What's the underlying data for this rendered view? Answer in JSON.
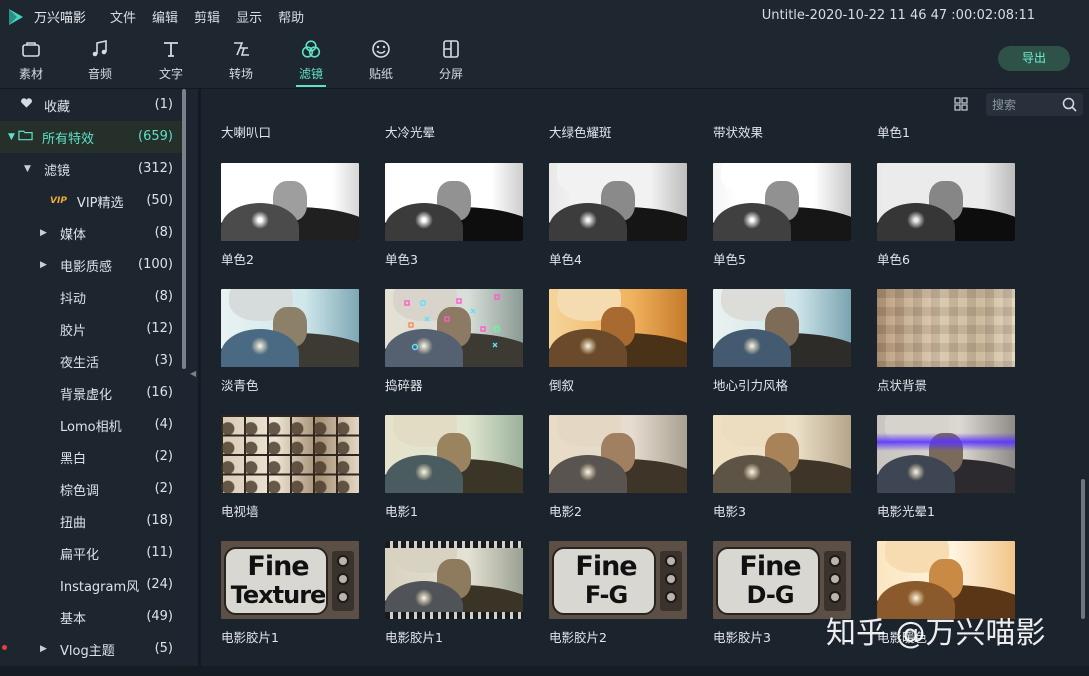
{
  "app": {
    "name": "万兴喵影",
    "project_title": "Untitle-2020-10-22 11 46 47 :00:02:08:11"
  },
  "menu": [
    "文件",
    "编辑",
    "剪辑",
    "显示",
    "帮助"
  ],
  "toolbar": {
    "tools": [
      {
        "label": "素材",
        "icon": "media-icon"
      },
      {
        "label": "音频",
        "icon": "music-icon"
      },
      {
        "label": "文字",
        "icon": "text-icon"
      },
      {
        "label": "转场",
        "icon": "transition-icon"
      },
      {
        "label": "滤镜",
        "icon": "filter-icon",
        "active": true
      },
      {
        "label": "贴纸",
        "icon": "sticker-icon"
      },
      {
        "label": "分屏",
        "icon": "split-screen-icon"
      }
    ],
    "export_label": "导出",
    "accent_color": "#5fe1c6"
  },
  "sidebar": {
    "items": [
      {
        "label": "收藏",
        "count": "(1)",
        "icon": "heart-icon"
      },
      {
        "label": "所有特效",
        "count": "(659)",
        "icon": "folder-icon",
        "expanded": true,
        "selected": true
      },
      {
        "label": "滤镜",
        "count": "(312)",
        "expanded": true
      },
      {
        "label": "VIP精选",
        "count": "(50)",
        "badge": "VIP"
      },
      {
        "label": "媒体",
        "count": "(8)",
        "collapsed": true
      },
      {
        "label": "电影质感",
        "count": "(100)",
        "collapsed": true
      },
      {
        "label": "抖动",
        "count": "(8)"
      },
      {
        "label": "胶片",
        "count": "(12)"
      },
      {
        "label": "夜生活",
        "count": "(3)"
      },
      {
        "label": "背景虚化",
        "count": "(16)"
      },
      {
        "label": "Lomo相机",
        "count": "(4)"
      },
      {
        "label": "黑白",
        "count": "(2)"
      },
      {
        "label": "棕色调",
        "count": "(2)"
      },
      {
        "label": "扭曲",
        "count": "(18)"
      },
      {
        "label": "扁平化",
        "count": "(11)"
      },
      {
        "label": "Instagram风",
        "count": "(24)"
      },
      {
        "label": "基本",
        "count": "(49)"
      },
      {
        "label": "Vlog主题",
        "count": "(5)",
        "collapsed": true
      }
    ]
  },
  "search": {
    "placeholder": "搜索"
  },
  "grid": {
    "top_row_labels": [
      "大喇叭口",
      "大冷光晕",
      "大绿色耀斑",
      "带状效果",
      "单色1"
    ],
    "rows": [
      [
        "单色2",
        "单色3",
        "单色4",
        "单色5",
        "单色6"
      ],
      [
        "淡青色",
        "捣碎器",
        "倒叙",
        "地心引力风格",
        "点状背景"
      ],
      [
        "电视墙",
        "电影1",
        "电影2",
        "电影3",
        "电影光晕1"
      ],
      [
        "电影胶片1",
        "电影胶片1",
        "电影胶片2",
        "电影胶片3",
        "电影暖色"
      ]
    ],
    "tv_texts": [
      [
        "Fine",
        "Texture"
      ],
      [
        "Fine",
        "F-G"
      ],
      [
        "Fine",
        "D-G"
      ]
    ]
  },
  "watermark": "知乎 @万兴喵影"
}
